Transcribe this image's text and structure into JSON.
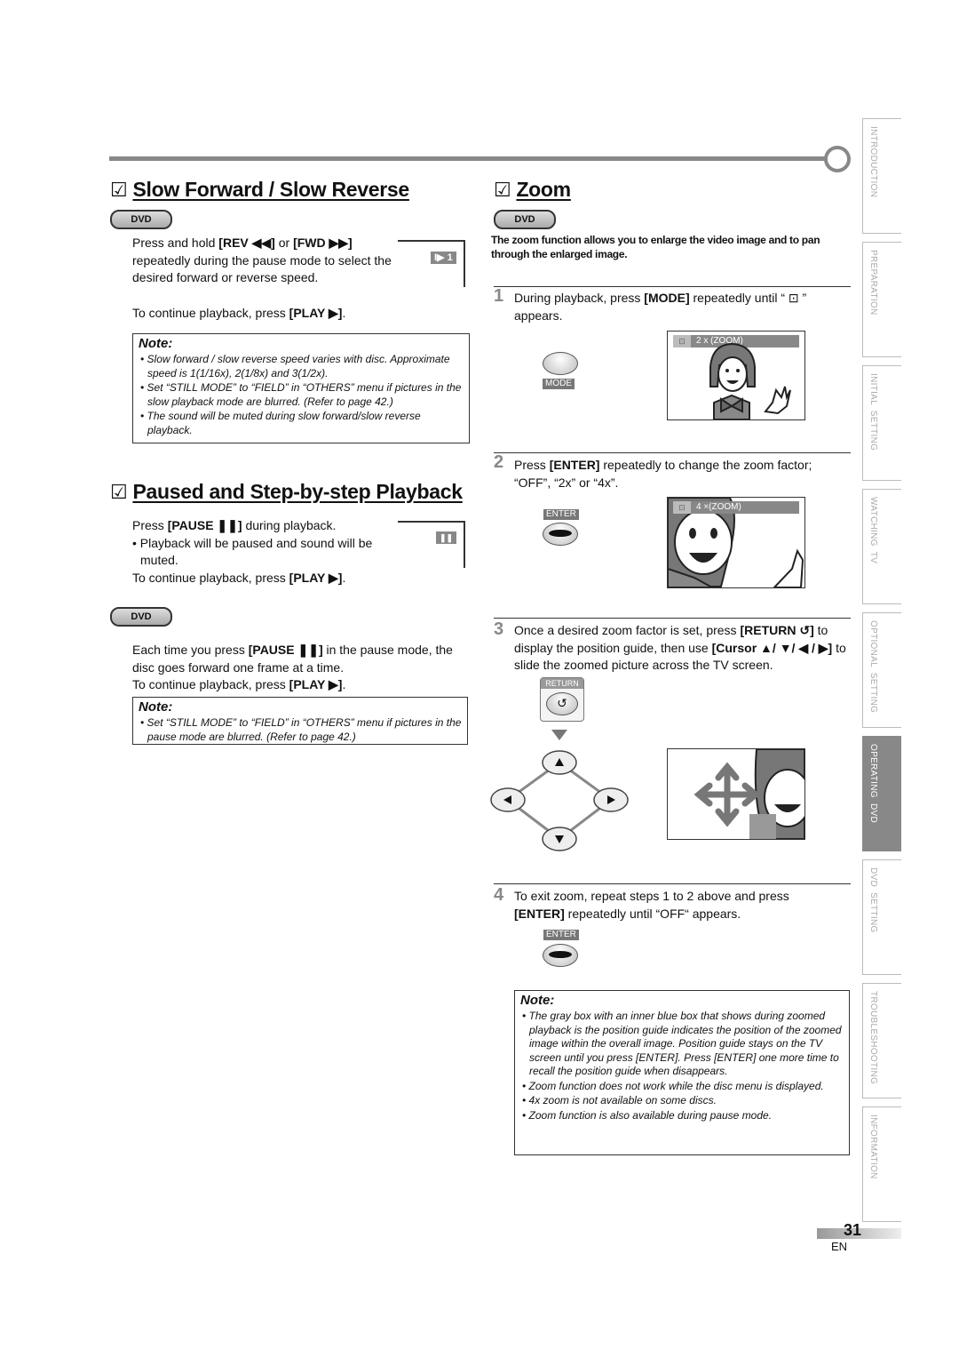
{
  "sections": {
    "slow": {
      "title": "Slow Forward / Slow Reverse",
      "badge": "DVD",
      "body_pre": "Press and hold ",
      "rev_key": "[REV ◀◀]",
      "or": " or ",
      "fwd_key": "[FWD ▶▶]",
      "body_post": "repeatedly during the pause mode to select the desired forward or reverse speed.",
      "osd": "I▶ 1",
      "continue_pre": "To continue playback, press ",
      "continue_key": "[PLAY ▶]",
      "continue_post": ".",
      "note_title": "Note:",
      "notes": [
        "Slow forward / slow reverse speed varies with disc. Approximate speed is 1(1/16x), 2(1/8x) and 3(1/2x).",
        "Set “STILL MODE”  to “FIELD” in “OTHERS” menu if pictures in the slow playback mode are blurred. (Refer to page 42.)",
        "The sound will be muted during slow forward/slow reverse playback."
      ]
    },
    "paused": {
      "title": "Paused and Step-by-step Playback",
      "press_pre": "Press ",
      "press_key": "[PAUSE ❚❚]",
      "press_post": " during playback.",
      "bullet": "• Playback will be paused and sound will be muted.",
      "osd": "❚❚",
      "continue_pre": "To continue playback, press ",
      "continue_key": "[PLAY ▶]",
      "continue_post": ".",
      "badge": "DVD",
      "step_pre": "Each time you press ",
      "step_key": "[PAUSE ❚❚]",
      "step_post": " in the pause mode, the disc goes forward one frame at a time.",
      "continue2_pre": "To continue playback, press ",
      "continue2_key": "[PLAY ▶]",
      "continue2_post": ".",
      "note_title": "Note:",
      "notes": [
        "Set “STILL MODE” to “FIELD” in “OTHERS” menu if pictures in the pause mode are blurred. (Refer to page 42.)"
      ]
    },
    "zoom": {
      "title": "Zoom",
      "badge": "DVD",
      "intro": "The zoom function allows you to enlarge the video image and to pan through the enlarged image.",
      "steps": [
        {
          "num": "1",
          "pre": "During playback, press ",
          "key": "[MODE]",
          "post": " repeatedly until “ ⊡ ” appears."
        },
        {
          "num": "2",
          "pre": "Press ",
          "key": "[ENTER]",
          "post": " repeatedly to change the zoom factor; “OFF”, “2x” or “4x”."
        },
        {
          "num": "3",
          "pre": "Once a desired zoom factor is set, press ",
          "key": "[RETURN ↺]",
          "mid": " to display the position guide, then use ",
          "key2": "[Cursor ▲/ ▼/ ◀ / ▶]",
          "post": " to slide the zoomed picture across the TV screen."
        },
        {
          "num": "4",
          "pre": "To exit zoom, repeat steps 1 to 2 above and press ",
          "key": "[ENTER]",
          "post": " repeatedly until “OFF“ appears."
        }
      ],
      "mode_label": "MODE",
      "enter_label": "ENTER",
      "return_label": "RETURN",
      "osd_2x": "2 x (ZOOM)",
      "osd_4x": "4 ×(ZOOM)",
      "note_title": "Note:",
      "notes": [
        "The gray box with an inner blue box that shows during zoomed playback is the position guide indicates the position of the zoomed image within the overall image. Position guide stays on the TV screen until you press [ENTER]. Press [ENTER] one more time to recall the position guide when disappears.",
        "Zoom function does not work while the disc menu is displayed.",
        "4x zoom is not available on some discs.",
        "Zoom function is also available during pause mode."
      ]
    }
  },
  "side_tabs": [
    {
      "label": "INTRODUCTION",
      "active": false
    },
    {
      "label": "PREPARATION",
      "active": false
    },
    {
      "label": "INITIAL  SETTING",
      "active": false
    },
    {
      "label": "WATCHING  TV",
      "active": false
    },
    {
      "label": "OPTIONAL  SETTING",
      "active": false
    },
    {
      "label": "OPERATING  DVD",
      "active": true
    },
    {
      "label": "DVD  SETTING",
      "active": false
    },
    {
      "label": "TROUBLESHOOTING",
      "active": false
    },
    {
      "label": "INFORMATION",
      "active": false
    }
  ],
  "footer": {
    "page": "31",
    "lang": "EN"
  }
}
